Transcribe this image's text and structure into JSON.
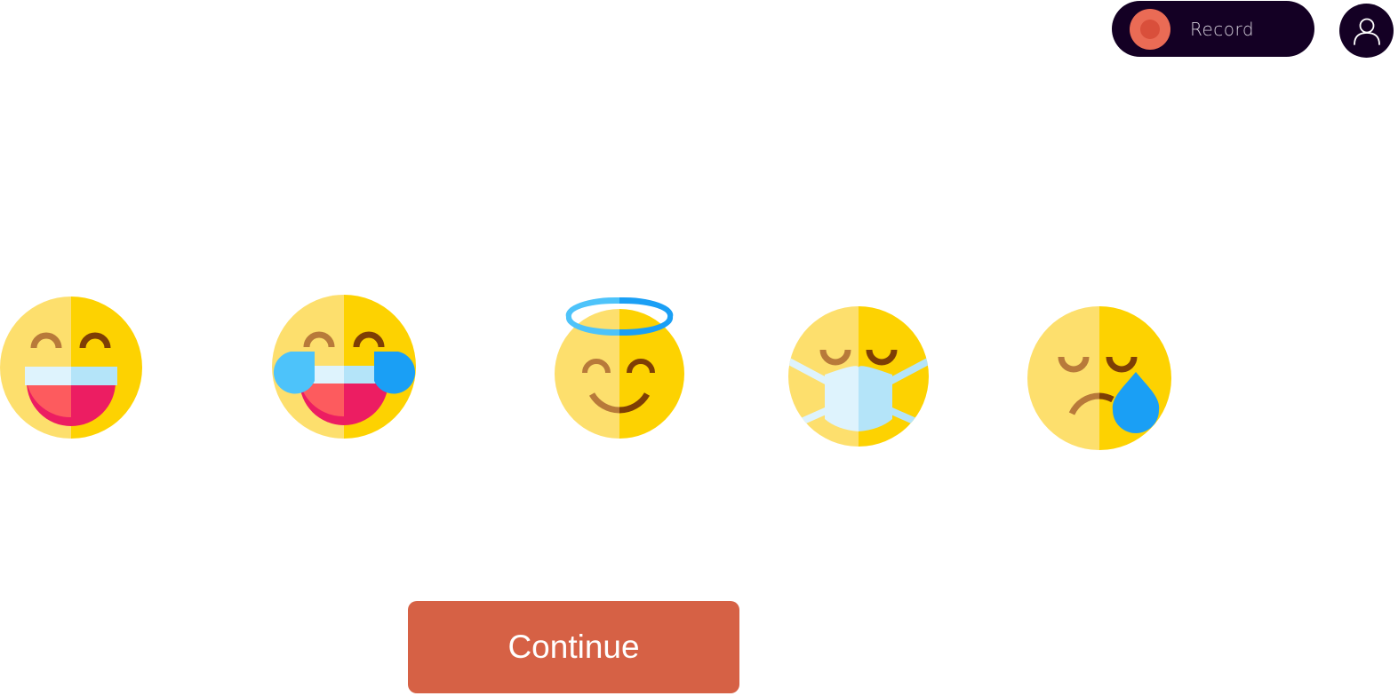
{
  "header": {
    "record_label": "Record",
    "record_icon": "record-dot-icon",
    "avatar_icon": "user-icon"
  },
  "emotions": [
    {
      "icon": "grinning-face-icon"
    },
    {
      "icon": "tears-of-joy-face-icon"
    },
    {
      "icon": "halo-smiling-face-icon"
    },
    {
      "icon": "medical-mask-face-icon"
    },
    {
      "icon": "crying-face-icon"
    }
  ],
  "footer": {
    "continue_label": "Continue"
  },
  "colors": {
    "dark": "#140024",
    "record_accent": "#ea6b55",
    "continue_button": "#d66145",
    "face_light": "#fddf6d",
    "face_dark": "#fdd201"
  }
}
